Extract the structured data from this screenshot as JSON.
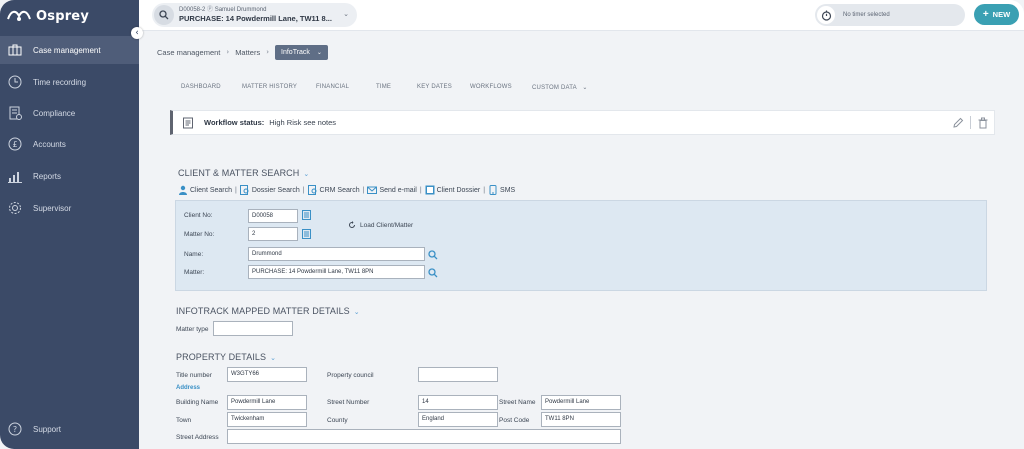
{
  "app": {
    "name": "Osprey"
  },
  "sidebar": {
    "items": [
      {
        "label": "Case management",
        "icon": "briefcase-icon",
        "active": true
      },
      {
        "label": "Time recording",
        "icon": "clock-icon",
        "active": false
      },
      {
        "label": "Compliance",
        "icon": "compliance-icon",
        "active": false
      },
      {
        "label": "Accounts",
        "icon": "currency-icon",
        "active": false
      },
      {
        "label": "Reports",
        "icon": "bar-chart-icon",
        "active": false
      },
      {
        "label": "Supervisor",
        "icon": "gear-icon",
        "active": false
      }
    ],
    "support": {
      "label": "Support",
      "icon": "help-icon"
    }
  },
  "topbar": {
    "matter_ref": "D00058-2",
    "client_name": "Samuel Drummond",
    "matter_title": "PURCHASE: 14 Powdermill Lane, TW11 8...",
    "timer_label": "No timer selected",
    "new_label": "NEW"
  },
  "breadcrumb": {
    "items": [
      "Case management",
      "Matters"
    ],
    "current": "InfoTrack"
  },
  "tabs": [
    "DASHBOARD",
    "MATTER HISTORY",
    "FINANCIAL",
    "TIME",
    "KEY DATES",
    "WORKFLOWS",
    "CUSTOM DATA"
  ],
  "workflow": {
    "label": "Workflow status:",
    "value": "High Risk see notes"
  },
  "client_search": {
    "title": "CLIENT & MATTER SEARCH",
    "links": [
      "Client Search",
      "Dossier Search",
      "CRM Search",
      "Send e-mail",
      "Client Dossier",
      "SMS"
    ],
    "client_no_label": "Client No:",
    "client_no": "D00058",
    "matter_no_label": "Matter No:",
    "matter_no": "2",
    "load_label": "Load Client/Matter",
    "name_label": "Name:",
    "name": "Drummond",
    "matter_label": "Matter:",
    "matter": "PURCHASE: 14 Powdermill Lane, TW11 8PN"
  },
  "mapped": {
    "title": "INFOTRACK MAPPED MATTER DETAILS",
    "matter_type_label": "Matter type",
    "matter_type": ""
  },
  "property": {
    "title": "PROPERTY DETAILS",
    "title_number_label": "Title number",
    "title_number": "W3GTY66",
    "property_council_label": "Property council",
    "property_council": "",
    "address_heading": "Address",
    "building_name_label": "Building Name",
    "building_name": "Powdermill Lane",
    "street_number_label": "Street Number",
    "street_number": "14",
    "street_name_label": "Street Name",
    "street_name": "Powdermill Lane",
    "town_label": "Town",
    "town": "Twickenham",
    "county_label": "County",
    "county": "England",
    "post_code_label": "Post Code",
    "post_code": "TW11 8PN",
    "street_address_label": "Street Address",
    "street_address": ""
  },
  "colors": {
    "sidebar": "#3b4a67",
    "accent": "#3aa0b3",
    "link": "#3a90c6"
  }
}
